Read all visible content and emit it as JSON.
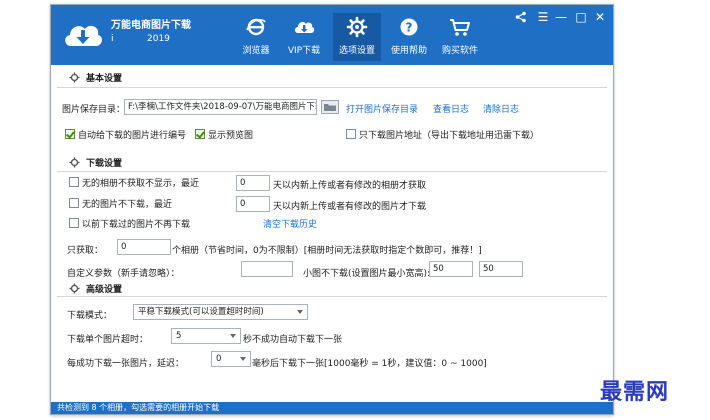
{
  "app": {
    "title": "万能电商图片下载",
    "version": "i",
    "year": "2019"
  },
  "nav": [
    {
      "label": "浏览器",
      "icon": "ie-browser-icon"
    },
    {
      "label": "VIP下载",
      "icon": "cloud-download-icon"
    },
    {
      "label": "选项设置",
      "icon": "gear-icon"
    },
    {
      "label": "使用帮助",
      "icon": "help-icon"
    },
    {
      "label": "购买软件",
      "icon": "cart-icon"
    }
  ],
  "window_controls": {
    "share": "<",
    "menu": "☰",
    "minimize": "—",
    "maximize": "□",
    "close": "✕"
  },
  "basic": {
    "heading": "基本设置",
    "save_dir_label": "图片保存目录：",
    "save_dir_value": "F:\\李楠\\工作文件夹\\2018-09-07\\万能电商图片下载\\",
    "open_dir_link": "打开图片保存目录",
    "view_log_link": "查看日志",
    "clear_log_link": "清除日志",
    "auto_number_label": "自动给下载的图片进行编号",
    "auto_number_checked": true,
    "show_preview_label": "显示预览图",
    "show_preview_checked": true,
    "only_address_label": "只下载图片地址（导出下载地址用迅雷下载）",
    "only_address_checked": false
  },
  "download": {
    "heading": "下载设置",
    "album_hide_label": "无的相册不获取不显示，最近",
    "album_hide_checked": false,
    "album_days": "0",
    "album_days_suffix": "天以内新上传或者有修改的相册才获取",
    "image_skip_label": "无的图片不下载，最近",
    "image_skip_checked": false,
    "image_days": "0",
    "image_days_suffix": "天以内新上传或者有修改的图片才下载",
    "no_redownload_label": "以前下载过的图片不再下载",
    "no_redownload_checked": false,
    "clear_history_link": "清空下载历史",
    "only_get_label": "只获取：",
    "only_get_value": "0",
    "only_get_suffix": "个相册（节省时间，0为不限制）[相册时间无法获取时指定个数即可，推荐！]",
    "custom_param_label": "自定义参数（新手请忽略）：",
    "custom_param_value": "",
    "small_skip_label": "小图不下载(设置图片最小宽高):",
    "min_width": "50",
    "min_height": "50"
  },
  "advanced": {
    "heading": "高级设置",
    "mode_label": "下载模式：",
    "mode_value": "平稳下载模式(可以设置超时时间)",
    "timeout_label": "下载单个图片超时：",
    "timeout_value": "5",
    "timeout_suffix": "秒不成功自动下载下一张",
    "delay_label": "每成功下载一张图片，延迟：",
    "delay_value": "0",
    "delay_suffix": "毫秒后下载下一张[1000毫秒 = 1秒，建议值：0 ~ 1000]"
  },
  "status": {
    "text": "共检测到 8 个相册，勾选需要的相册开始下载"
  },
  "watermark": {
    "text": "最需网"
  },
  "colors": {
    "titlebar": "#1f6fc5",
    "link": "#1a6fd6",
    "watermark": "#2a3bbd"
  }
}
